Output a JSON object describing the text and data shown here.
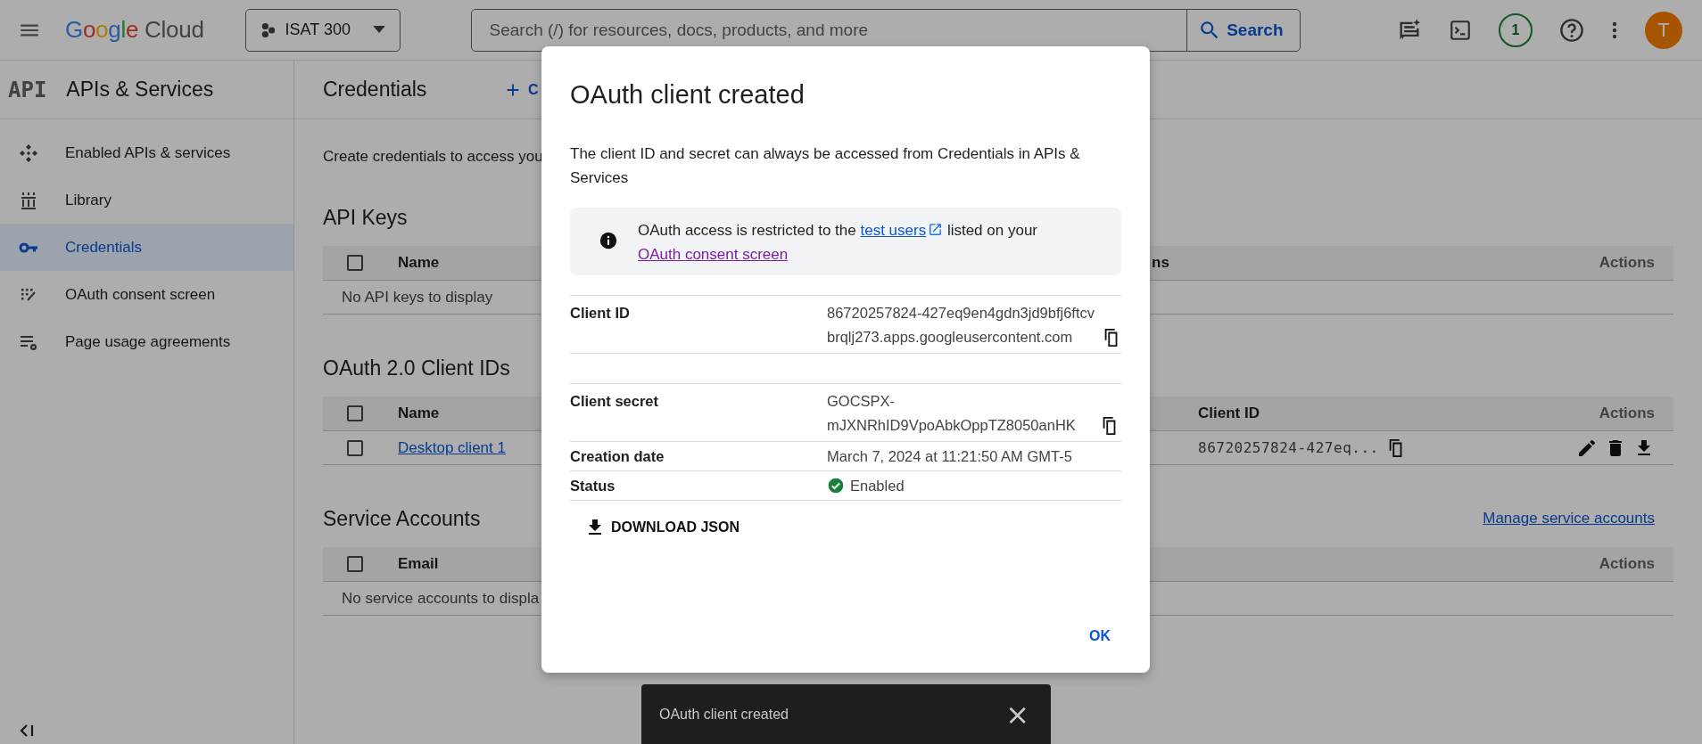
{
  "topbar": {
    "logo": {
      "google": "Google",
      "cloud": "Cloud"
    },
    "project": "ISAT 300",
    "search": {
      "placeholder": "Search (/) for resources, docs, products, and more",
      "button": "Search"
    },
    "notifications": "1",
    "avatar": "T"
  },
  "sidebar": {
    "logo": "API",
    "title": "APIs & Services",
    "items": [
      {
        "label": "Enabled APIs & services",
        "selected": false
      },
      {
        "label": "Library",
        "selected": false
      },
      {
        "label": "Credentials",
        "selected": true
      },
      {
        "label": "OAuth consent screen",
        "selected": false
      },
      {
        "label": "Page usage agreements",
        "selected": false
      }
    ]
  },
  "main": {
    "title": "Credentials",
    "create_button": "C",
    "description": "Create credentials to access you",
    "sections": [
      {
        "title": "API Keys",
        "header_checked": false,
        "columns": [
          {
            "label": "Name",
            "kind": "name"
          },
          {
            "label": "ns",
            "kind": "cut"
          },
          {
            "label": "Actions",
            "kind": "actions"
          }
        ],
        "empty": "No API keys to display"
      },
      {
        "title": "OAuth 2.0 Client IDs",
        "header_checked": false,
        "columns": [
          {
            "label": "Name",
            "kind": "name"
          },
          {
            "label": "Client ID",
            "kind": "id"
          },
          {
            "label": "Actions",
            "kind": "actions"
          }
        ],
        "rows": [
          {
            "name": "Desktop client 1",
            "client_id": "86720257824-427eq...",
            "checked": false
          }
        ]
      },
      {
        "title": "Service Accounts",
        "link": "Manage service accounts",
        "header_checked": false,
        "columns": [
          {
            "label": "Email",
            "kind": "name"
          },
          {
            "label": "Actions",
            "kind": "actions"
          }
        ],
        "empty": "No service accounts to displa"
      }
    ]
  },
  "dialog": {
    "title": "OAuth client created",
    "description": "The client ID and secret can always be accessed from Credentials in APIs & Services",
    "info": {
      "before": "OAuth access is restricted to the ",
      "link1": {
        "text": "test users",
        "visited": false
      },
      "middle": " listed on your ",
      "link2": {
        "text": "OAuth consent screen",
        "visited": true
      }
    },
    "fields": [
      {
        "kind": "id",
        "label": "Client ID",
        "value": "86720257824-427eq9en4gdn3jd9bfj6ftcvbrqlj273.apps.googleusercontent.com",
        "copy": true
      },
      {
        "kind": "spacer"
      },
      {
        "kind": "secret",
        "label": "Client secret",
        "value": "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",
        "copy": true
      },
      {
        "kind": "text",
        "label": "Creation date",
        "value": "March 7, 2024 at 11:21:50 AM GMT-5",
        "copy": false
      },
      {
        "kind": "status",
        "label": "Status",
        "value": "Enabled",
        "copy": false
      }
    ],
    "download": "DOWNLOAD JSON",
    "ok": "OK"
  },
  "snackbar": {
    "text": "OAuth client created",
    "close": "×"
  }
}
